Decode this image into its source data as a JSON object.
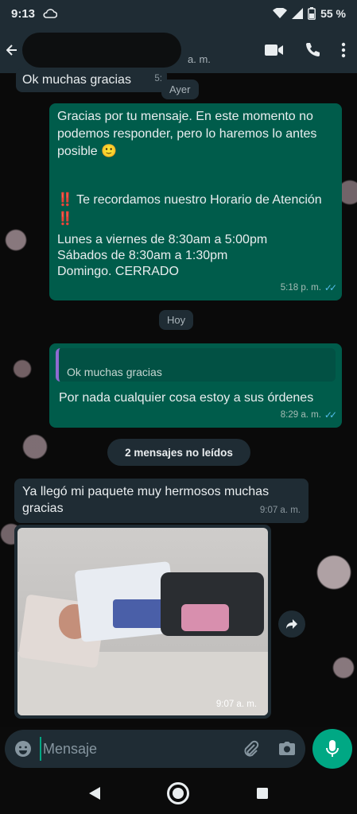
{
  "status_bar": {
    "time": "9:13",
    "battery": "55 %",
    "icons": [
      "cloud-icon",
      "wifi-icon",
      "signal-icon",
      "battery-icon"
    ]
  },
  "header": {
    "contact_suffix": "a. m.",
    "actions": [
      "video-call-icon",
      "voice-call-icon",
      "more-options-icon"
    ]
  },
  "chat": {
    "partial_message": {
      "text": "Ok muchas gracias",
      "time": "5:"
    },
    "date_yesterday": "Ayer",
    "auto_reply": {
      "line1": "Gracias por tu mensaje. En este momento no podemos responder, pero lo haremos lo antes posible 🙂",
      "line2": "‼️ Te recordamos nuestro Horario de Atención ‼️",
      "line3": "Lunes a viernes de 8:30am a 5:00pm",
      "line4": "Sábados de 8:30am a 1:30pm",
      "line5": "Domingo. CERRADO",
      "time": "5:18 p. m."
    },
    "date_today": "Hoy",
    "reply_message": {
      "quoted_text": "Ok muchas gracias",
      "text": "Por nada cualquier cosa estoy a sus órdenes",
      "time": "8:29 a. m."
    },
    "unread_label": "2 mensajes no leídos",
    "incoming_message": {
      "text": "Ya llegó mi paquete muy hermosos muchas gracias",
      "time": "9:07 a. m."
    },
    "photo_message": {
      "time": "9:07 a. m."
    }
  },
  "composer": {
    "placeholder": "Mensaje",
    "icons": [
      "emoji-icon",
      "attach-icon",
      "camera-icon",
      "mic-icon"
    ]
  },
  "nav": {
    "icons": [
      "back-triangle-icon",
      "home-circle-icon",
      "recents-square-icon"
    ]
  },
  "colors": {
    "outgoing_bubble": "#005c4b",
    "incoming_bubble": "#1f2c34",
    "accent": "#00a884",
    "read_ticks": "#53bdeb"
  }
}
